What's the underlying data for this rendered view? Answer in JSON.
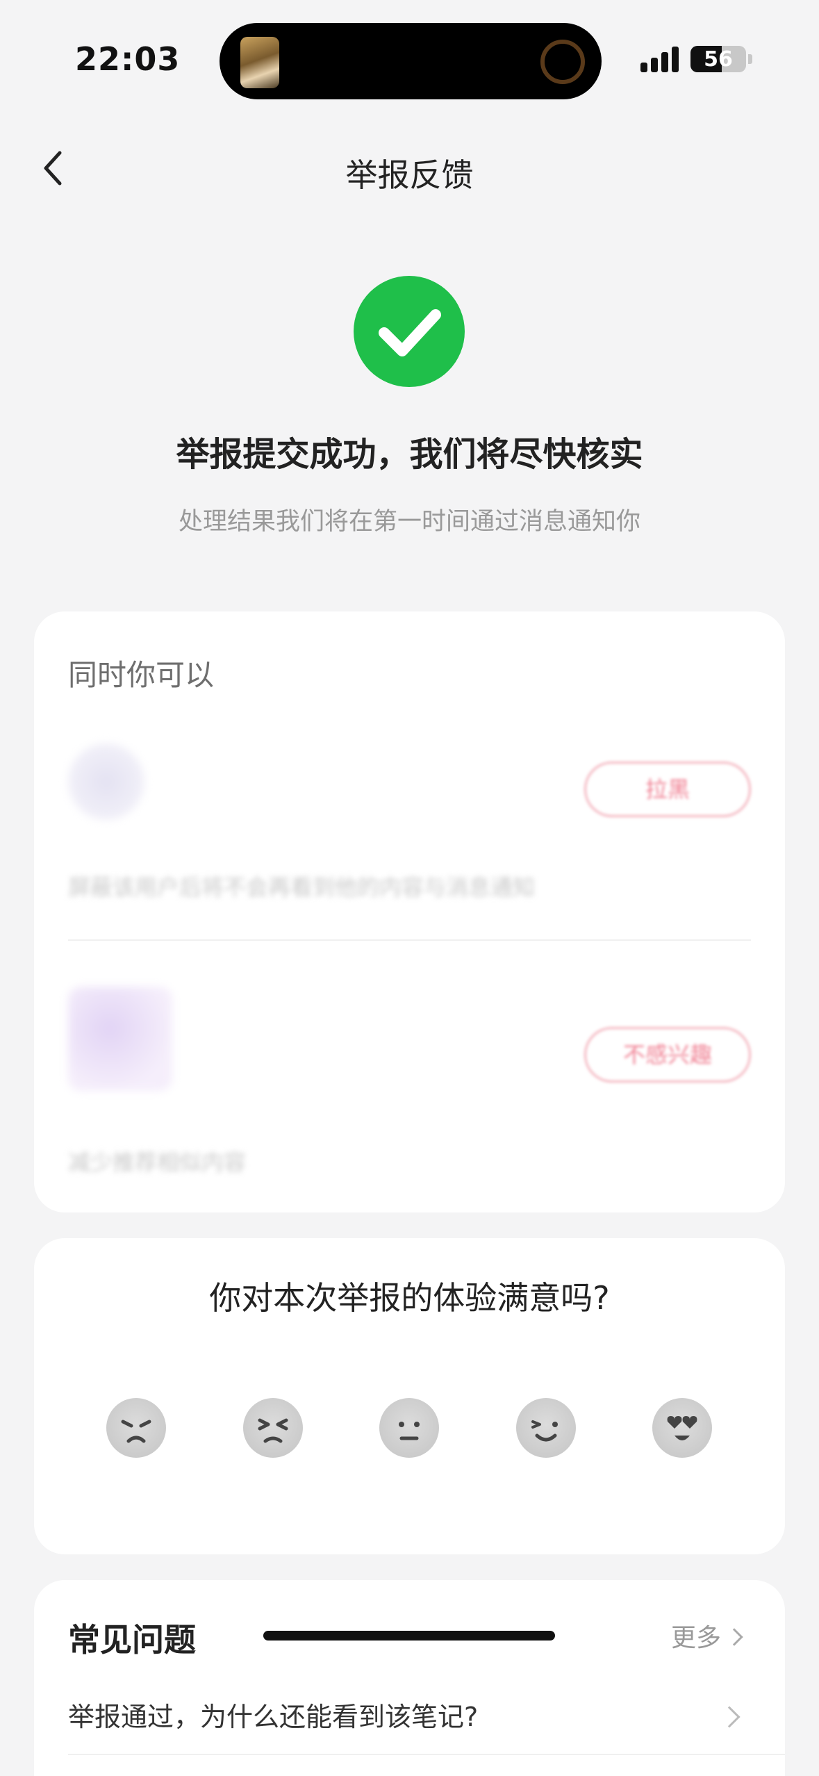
{
  "status_bar": {
    "time": "22:03",
    "battery_level": "56",
    "battery_fraction": 0.56
  },
  "nav": {
    "title": "举报反馈"
  },
  "success": {
    "title": "举报提交成功，我们将尽快核实",
    "subtitle": "处理结果我们将在第一时间通过消息通知你",
    "accent_color": "#1fbf4a"
  },
  "recommend": {
    "heading": "同时你可以",
    "items": [
      {
        "name": "",
        "desc": "屏蔽该用户后将不会再看到他的内容与消息通知",
        "button": "拉黑"
      },
      {
        "name": "",
        "desc": "减少推荐相似内容",
        "button": "不感兴趣"
      }
    ]
  },
  "rating": {
    "question": "你对本次举报的体验满意吗?",
    "options": [
      "angry-face-icon",
      "frustrated-face-icon",
      "neutral-face-icon",
      "smiling-face-icon",
      "heart-eyes-face-icon"
    ]
  },
  "faq": {
    "title": "常见问题",
    "more_label": "更多",
    "items": [
      {
        "question": "举报通过，为什么还能看到该笔记?"
      }
    ]
  }
}
